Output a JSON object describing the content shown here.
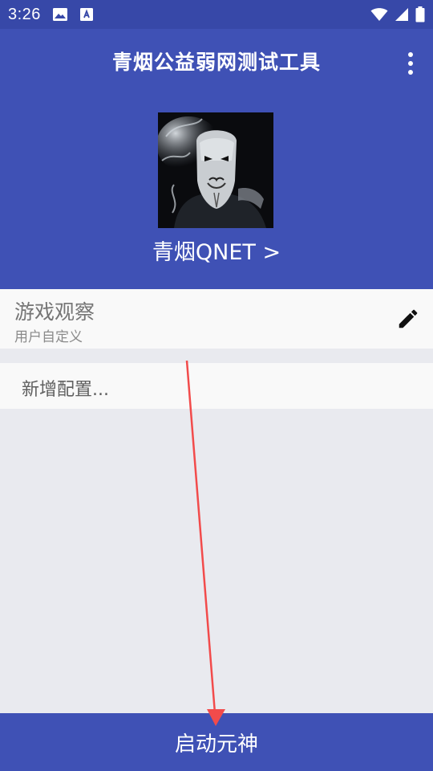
{
  "status_bar": {
    "time": "3:26",
    "icons": [
      "image-icon",
      "font-download-icon",
      "wifi-icon",
      "signal-icon",
      "battery-icon"
    ]
  },
  "header": {
    "title": "青烟公益弱网测试工具",
    "profile_name": "青烟QNET >",
    "background_color": "#3f51b5"
  },
  "game_card": {
    "title": "游戏观察",
    "subtitle": "用户自定义"
  },
  "add_config": {
    "label": "新增配置..."
  },
  "start_button": {
    "label": "启动元神"
  },
  "annotation": {
    "color": "#f24b4b"
  }
}
